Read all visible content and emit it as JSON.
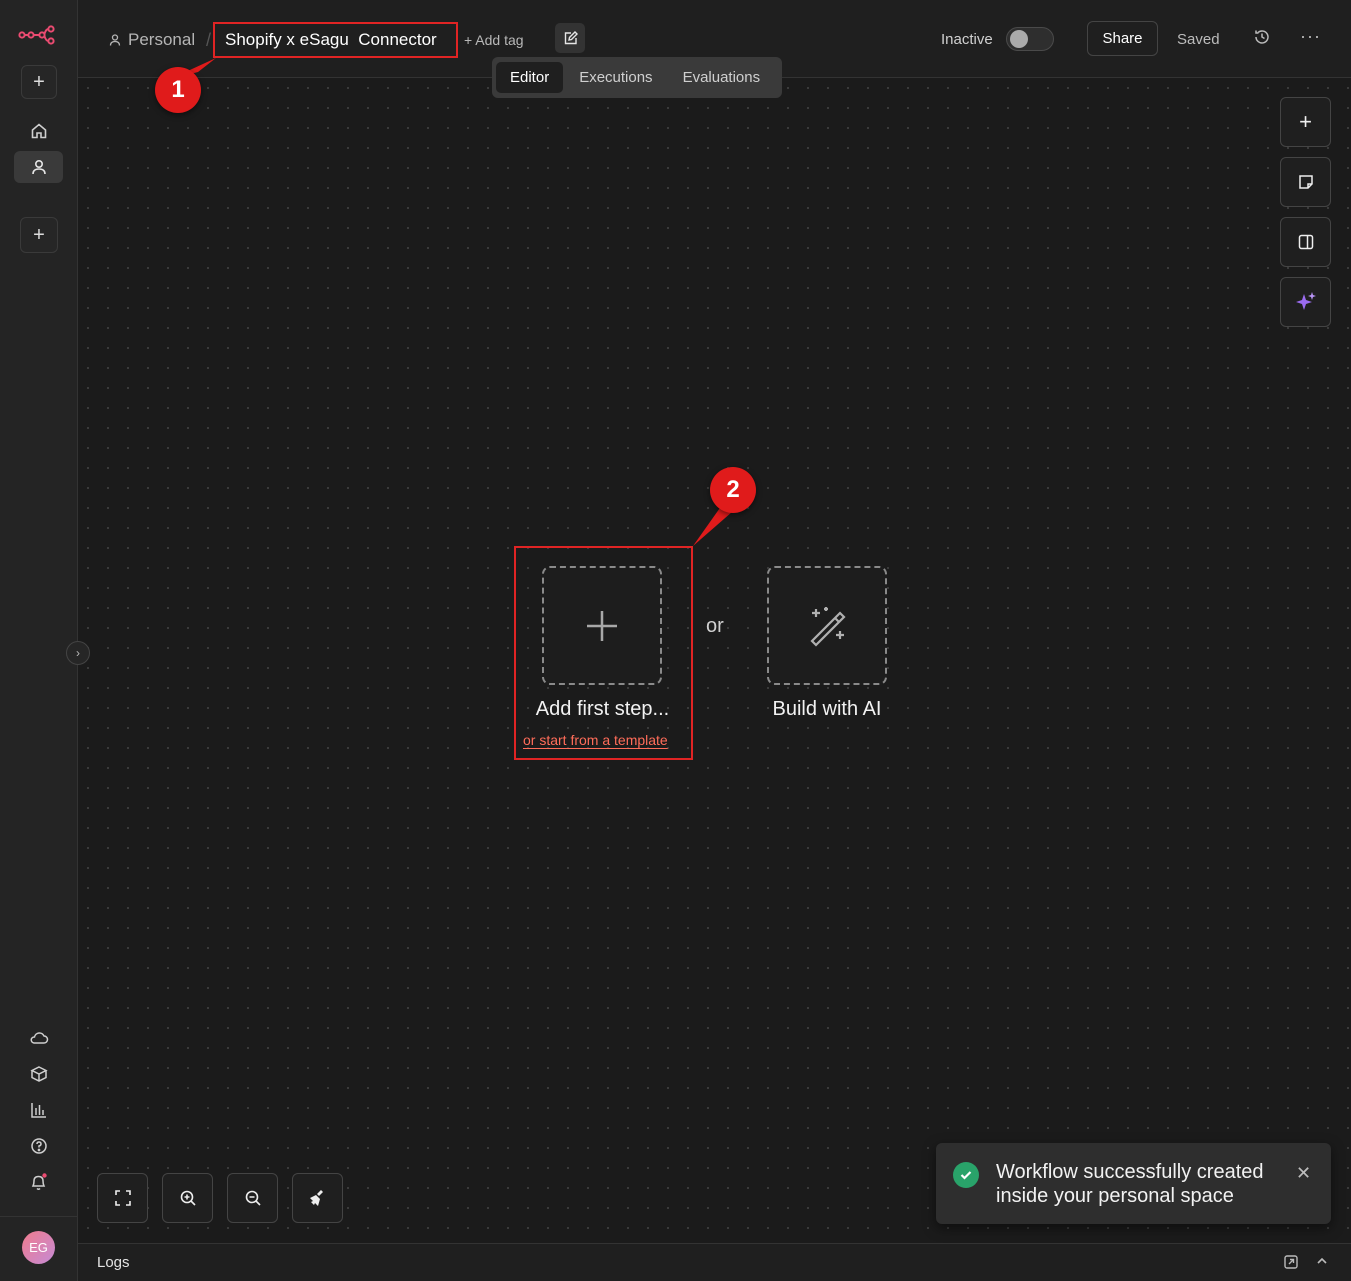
{
  "header": {
    "breadcrumb_personal": "Personal",
    "breadcrumb_separator": "/",
    "workflow_name": "Shopify x eSagu  Connector",
    "add_tag_label": "+ Add tag",
    "tabs": [
      {
        "label": "Editor",
        "active": true
      },
      {
        "label": "Executions",
        "active": false
      },
      {
        "label": "Evaluations",
        "active": false
      }
    ],
    "status_label": "Inactive",
    "active_toggle": false,
    "share_label": "Share",
    "save_status": "Saved",
    "more_label": "···"
  },
  "sidebar": {
    "avatar_initials": "EG",
    "has_notification": true
  },
  "canvas": {
    "add_first_step_label": "Add first step...",
    "template_link_label": "or start from a template",
    "or_label": "or",
    "build_with_ai_label": "Build with AI"
  },
  "annotations": {
    "badge_1": "1",
    "badge_2": "2"
  },
  "toast": {
    "message": "Workflow successfully created inside your personal space",
    "type": "success"
  },
  "logs": {
    "label": "Logs"
  },
  "colors": {
    "brand": "#ea4b71",
    "accent_link": "#ff6d5a",
    "annotation_red": "#e02424",
    "success": "#29a36a",
    "ai_sparkle": "#9b6cf0"
  }
}
